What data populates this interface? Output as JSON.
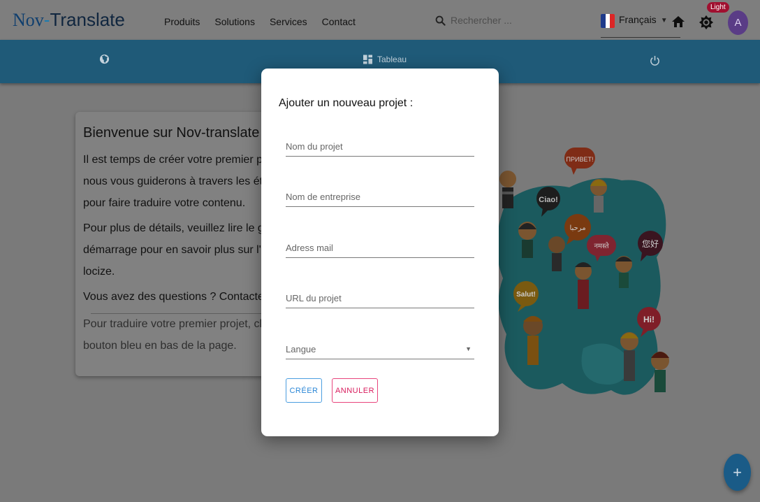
{
  "brand": {
    "part1": "Nov",
    "dash": "-",
    "part2": "Translate"
  },
  "nav": {
    "items": [
      "Produits",
      "Solutions",
      "Services",
      "Contact"
    ]
  },
  "search": {
    "placeholder": "Rechercher ..."
  },
  "language": {
    "selected": "Français",
    "flag_colors": [
      "#1e3a8a",
      "#ffffff",
      "#dc2626"
    ]
  },
  "theme": {
    "badge": "Light"
  },
  "user": {
    "avatar_initial": "A"
  },
  "toolbar": {
    "tableau_label": "Tableau"
  },
  "welcome": {
    "title": "Bienvenue sur Nov-translate",
    "line1": "Il est temps de créer votre premier projet.",
    "line2": "nous vous guiderons à travers les étapes",
    "line3": "pour faire traduire votre contenu.",
    "line4": "Pour plus de détails, veuillez lire le guide",
    "line5": "démarrage pour en savoir plus sur l'utilisa",
    "line6": "locize.",
    "line7": "Vous avez des questions ? Contactez-nou",
    "line8": "Pour traduire votre premier projet, cliquez",
    "line9": "bouton bleu en bas de la page."
  },
  "illustration": {
    "bubbles": [
      "ПРИВЕТ!",
      "Ciao!",
      "مرحبا",
      "नमस्ते",
      "您好",
      "Salut!",
      "Hi!"
    ]
  },
  "modal": {
    "title": "Ajouter un nouveau projet :",
    "fields": {
      "project_name": "Nom du projet",
      "company_name": "Nom de entreprise",
      "email": "Adress mail",
      "project_url": "URL du projet",
      "language": "Langue"
    },
    "create_label": "CRÉER",
    "cancel_label": "ANNULER"
  },
  "fab": {
    "label": "+"
  },
  "colors": {
    "toolbar": "#1f5a78",
    "create_accent": "#2a86d6",
    "cancel_accent": "#d81b5c",
    "fab": "#1a5b87"
  }
}
